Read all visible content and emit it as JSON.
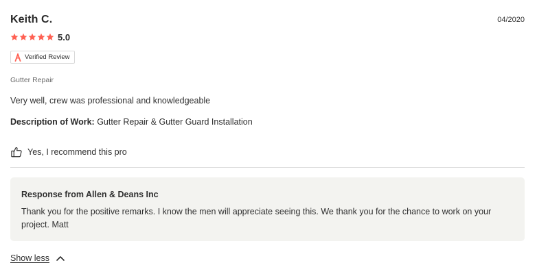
{
  "review": {
    "reviewer_name": "Keith C.",
    "date": "04/2020",
    "rating": "5.0",
    "rating_value": 5,
    "rating_max": 5,
    "star_color": "#ff6153",
    "verified_label": "Verified Review",
    "verified_icon": "angi-logo-icon",
    "brand_color": "#ff6153",
    "service": "Gutter Repair",
    "text": "Very well, crew was professional and knowledgeable",
    "description_label": "Description of Work:",
    "description_value": "Gutter Repair & Gutter Guard Installation",
    "recommend_icon": "thumbs-up-icon",
    "recommend_text": "Yes, I recommend this pro"
  },
  "response": {
    "title": "Response from Allen & Deans Inc",
    "body": "Thank you for the positive remarks. I know the men will appreciate seeing this. We thank you for the chance to work on your project. Matt"
  },
  "toggle": {
    "label": "Show less",
    "icon": "chevron-up-icon"
  }
}
